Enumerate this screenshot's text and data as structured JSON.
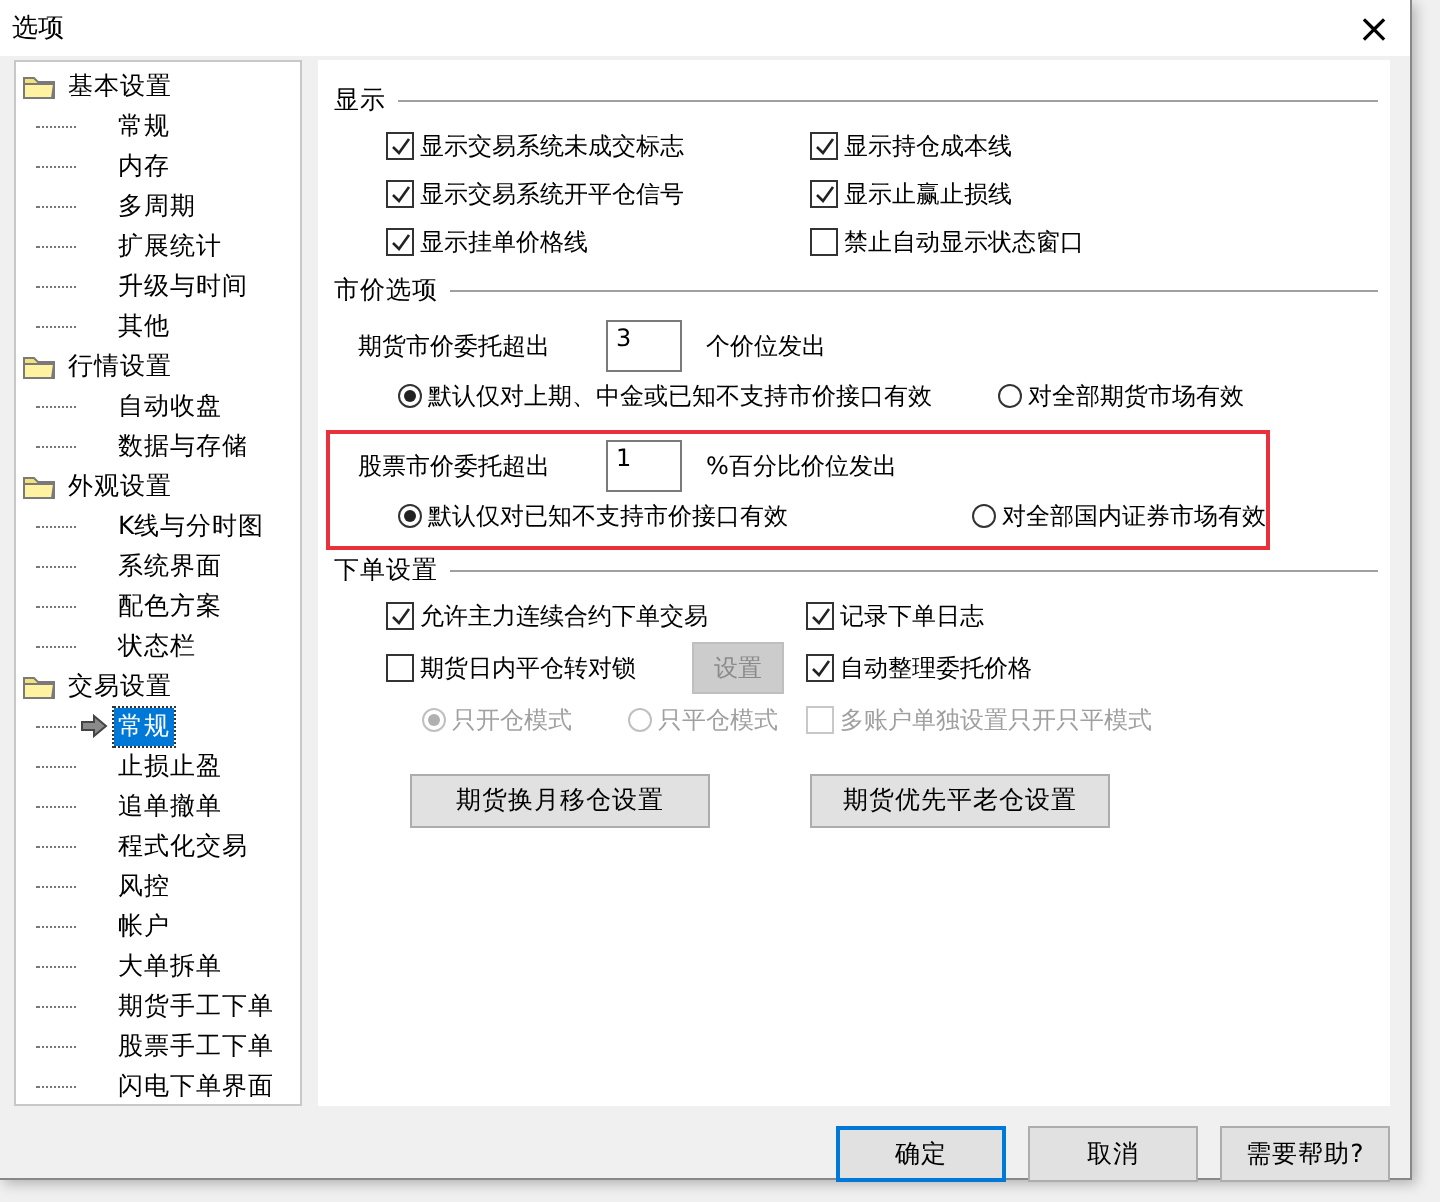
{
  "window": {
    "title": "选项",
    "close": "×"
  },
  "tree": [
    {
      "label": "基本设置",
      "children": [
        {
          "label": "常规",
          "selected": false
        },
        {
          "label": "内存",
          "selected": false
        },
        {
          "label": "多周期",
          "selected": false
        },
        {
          "label": "扩展统计",
          "selected": false
        },
        {
          "label": "升级与时间",
          "selected": false
        },
        {
          "label": "其他",
          "selected": false
        }
      ]
    },
    {
      "label": "行情设置",
      "children": [
        {
          "label": "自动收盘",
          "selected": false
        },
        {
          "label": "数据与存储",
          "selected": false
        }
      ]
    },
    {
      "label": "外观设置",
      "children": [
        {
          "label": "K线与分时图",
          "selected": false
        },
        {
          "label": "系统界面",
          "selected": false
        },
        {
          "label": "配色方案",
          "selected": false
        },
        {
          "label": "状态栏",
          "selected": false
        }
      ]
    },
    {
      "label": "交易设置",
      "children": [
        {
          "label": "常规",
          "selected": true
        },
        {
          "label": "止损止盈",
          "selected": false
        },
        {
          "label": "追单撤单",
          "selected": false
        },
        {
          "label": "程式化交易",
          "selected": false
        },
        {
          "label": "风控",
          "selected": false
        },
        {
          "label": "帐户",
          "selected": false
        },
        {
          "label": "大单拆单",
          "selected": false
        },
        {
          "label": "期货手工下单",
          "selected": false
        },
        {
          "label": "股票手工下单",
          "selected": false
        },
        {
          "label": "闪电下单界面",
          "selected": false
        }
      ]
    }
  ],
  "display": {
    "title": "显示",
    "checkboxes": [
      {
        "label": "显示交易系统未成交标志",
        "checked": true
      },
      {
        "label": "显示持仓成本线",
        "checked": true
      },
      {
        "label": "显示交易系统开平仓信号",
        "checked": true
      },
      {
        "label": "显示止赢止损线",
        "checked": true
      },
      {
        "label": "显示挂单价格线",
        "checked": true
      },
      {
        "label": "禁止自动显示状态窗口",
        "checked": false
      }
    ]
  },
  "market": {
    "title": "市价选项",
    "groups": [
      {
        "label": "期货市价委托超出",
        "value": "3",
        "suffix": "个价位发出",
        "highlighted": false,
        "radios": [
          {
            "label": "默认仅对上期、中金或已知不支持市价接口有效",
            "selected": true
          },
          {
            "label": "对全部期货市场有效",
            "selected": false
          }
        ]
      },
      {
        "label": "股票市价委托超出",
        "value": "1",
        "suffix": "%百分比价位发出",
        "highlighted": true,
        "radios": [
          {
            "label": "默认仅对已知不支持市价接口有效",
            "selected": true
          },
          {
            "label": "对全部国内证券市场有效",
            "selected": false
          }
        ]
      }
    ]
  },
  "order": {
    "title": "下单设置",
    "rows": [
      {
        "left": [
          {
            "kind": "checkbox",
            "label": "允许主力连续合约下单交易",
            "checked": true,
            "disabled": false
          }
        ],
        "right": [
          {
            "kind": "checkbox",
            "label": "记录下单日志",
            "checked": true,
            "disabled": false
          }
        ]
      },
      {
        "left": [
          {
            "kind": "checkbox",
            "label": "期货日内平仓转对锁",
            "checked": false,
            "disabled": false
          },
          {
            "kind": "button",
            "label": "设置",
            "disabled": true
          }
        ],
        "right": [
          {
            "kind": "checkbox",
            "label": "自动整理委托价格",
            "checked": true,
            "disabled": false
          }
        ]
      },
      {
        "left": [
          {
            "kind": "radio",
            "label": "只开仓模式",
            "selected": true,
            "disabled": true
          },
          {
            "kind": "radio",
            "label": "只平仓模式",
            "selected": false,
            "disabled": true
          }
        ],
        "right": [
          {
            "kind": "checkbox",
            "label": "多账户单独设置只开只平模式",
            "checked": false,
            "disabled": true
          }
        ]
      }
    ],
    "buttons": [
      "期货换月移仓设置",
      "期货优先平老仓设置"
    ]
  },
  "footer": [
    {
      "label": "确定",
      "default": true
    },
    {
      "label": "取消",
      "default": false
    },
    {
      "label": "需要帮助?",
      "default": false
    }
  ]
}
